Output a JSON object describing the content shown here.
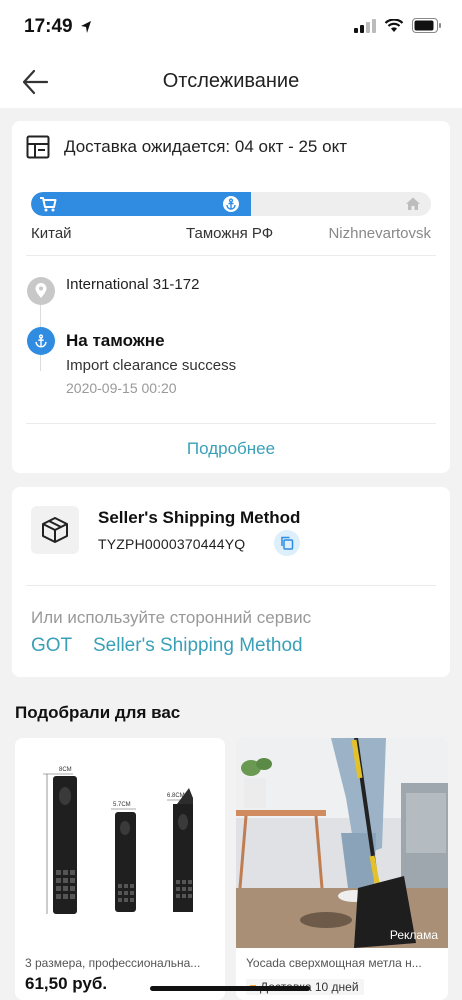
{
  "status_bar": {
    "time": "17:49"
  },
  "nav": {
    "title": "Отслеживание"
  },
  "delivery": {
    "text": "Доставка ожидается: 04 окт - 25 окт"
  },
  "progress": {
    "fraction": 0.55,
    "stages": [
      "Китай",
      "Таможня РФ",
      "Nizhnevartovsk"
    ],
    "accent_color": "#2f8ce0"
  },
  "timeline": {
    "location": "International 31-172",
    "status": "На таможне",
    "detail": "Import clearance success",
    "time": "2020-09-15 00:20"
  },
  "more_link": "Подробнее",
  "shipping": {
    "method": "Seller's Shipping Method",
    "tracking": "TYZPH0000370444YQ"
  },
  "third_party": {
    "text": "Или используйте сторонний сервис",
    "links": [
      "GOT",
      "Seller's Shipping Method"
    ],
    "link_color": "#3aa0b8"
  },
  "recommendations": {
    "title": "Подобрали для вас",
    "products": [
      {
        "name": "3 размера, профессиональна...",
        "price": "61,50 руб.",
        "size_labels": [
          "8CM",
          "5.7CM",
          "6.8CM"
        ]
      },
      {
        "name": "Yocada сверхмощная метла н...",
        "ad_label": "Реклама",
        "delivery_badge": "Доставка 10 дней"
      }
    ]
  }
}
